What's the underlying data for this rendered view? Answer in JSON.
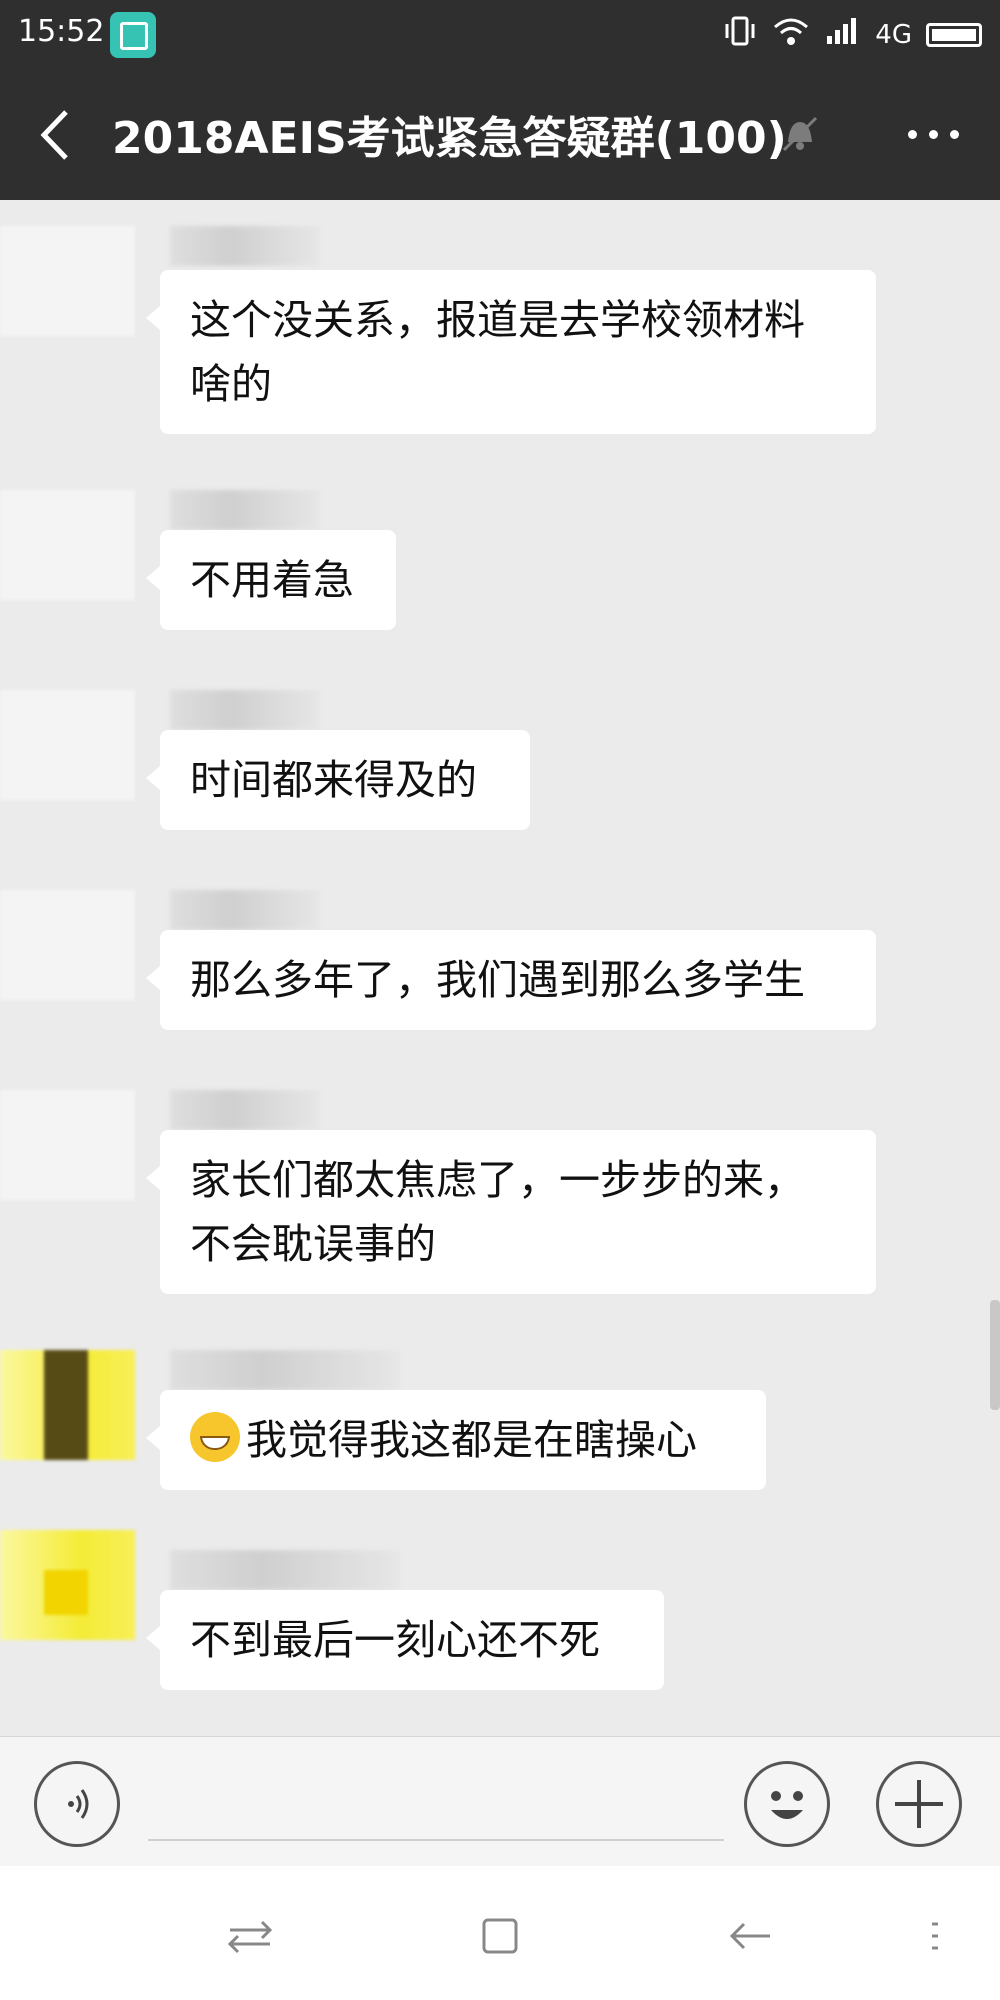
{
  "status_bar": {
    "time": "15:52",
    "network": "4G"
  },
  "header": {
    "title": "2018AEIS考试紧急答疑群(100)"
  },
  "messages": [
    {
      "text": "这个没关系，报道是去学校领材料\n啥的"
    },
    {
      "text": "不用着急"
    },
    {
      "text": "时间都来得及的"
    },
    {
      "text": "那么多年了，我们遇到那么多学生"
    },
    {
      "text": "家长们都太焦虑了，一步步的来，\n不会耽误事的"
    },
    {
      "text": "我觉得我这都是在瞎操心"
    },
    {
      "text": "不到最后一刻心还不死"
    }
  ],
  "input": {
    "placeholder": ""
  },
  "icons": {
    "back": "back-chevron-icon",
    "mute": "bell-mute-icon",
    "more": "more-dots-icon",
    "voice": "voice-icon",
    "emoji": "emoji-icon",
    "plus": "plus-icon"
  },
  "colors": {
    "header_bg": "#2f2f2f",
    "chat_bg": "#ebebeb",
    "bubble": "#ffffff"
  }
}
